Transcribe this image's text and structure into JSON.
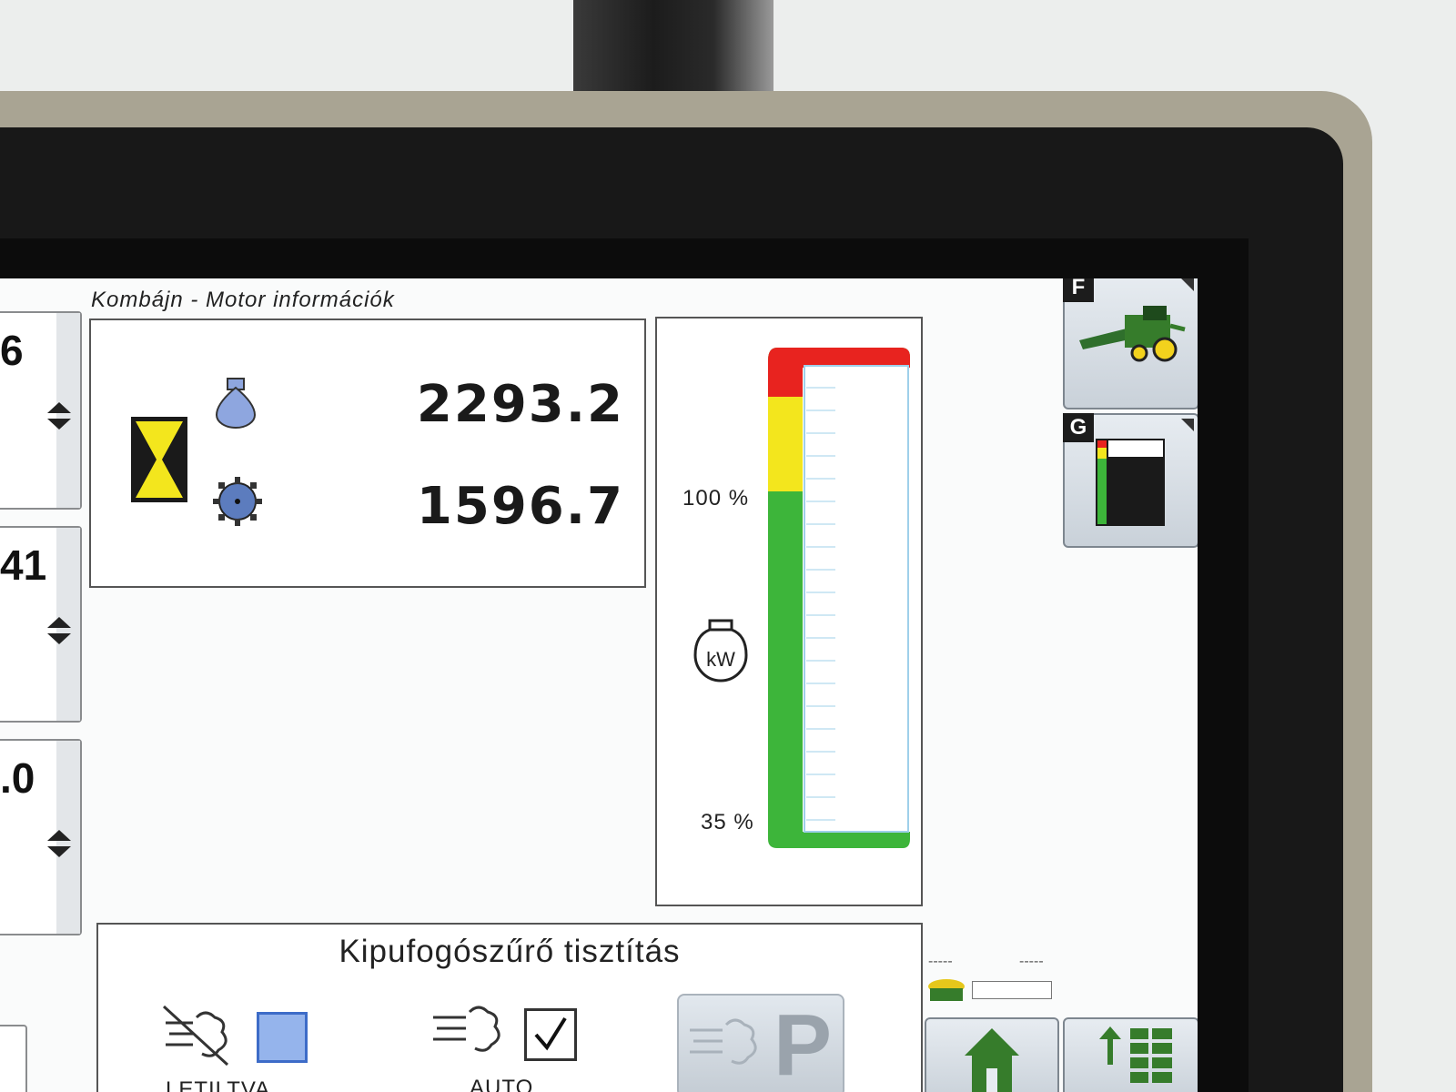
{
  "screen": {
    "title": "Kombájn - Motor információk"
  },
  "left_panels": [
    {
      "value": "6"
    },
    {
      "value": "41"
    },
    {
      "value": ".0"
    }
  ],
  "engine_info": {
    "fuel_value": "2293.2",
    "rpm_value": "1596.7",
    "fuel_icon": "fuel-drop-icon",
    "rpm_icon": "engine-speed-gear-icon",
    "hourglass_icon": "hourglass-icon"
  },
  "engine_load": {
    "label_100": "100 %",
    "label_35": "35 %",
    "unit_icon_text": "kW",
    "level": 0.0,
    "colors": {
      "red": "#e8231f",
      "yellow": "#f3e61d",
      "green": "#3db53a"
    }
  },
  "dpf_cleaning": {
    "title": "Kipufogószűrő tisztítás",
    "disabled_label": "LETILTVA",
    "auto_label": "AUTO",
    "disabled_checked": false,
    "auto_checked": true,
    "park_letter": "P"
  },
  "side_buttons": [
    {
      "key": "F",
      "icon": "combine-harvester-icon"
    },
    {
      "key": "G",
      "icon": "load-gauge-icon"
    }
  ],
  "status_row": {
    "dash_left": "-----",
    "dash_right": "-----"
  }
}
